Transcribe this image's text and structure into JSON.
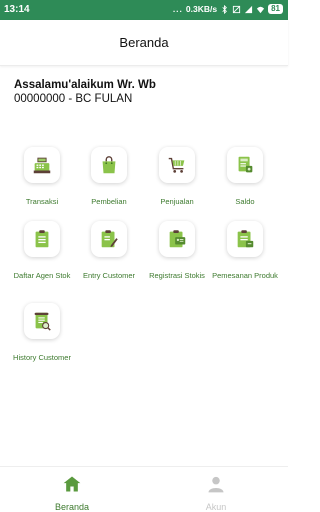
{
  "status_bar": {
    "time": "13:14",
    "dots": "...",
    "speed": "0.3KB/s",
    "battery": "81"
  },
  "header": {
    "title": "Beranda"
  },
  "user": {
    "greeting": "Assalamu'alaikum Wr. Wb",
    "account": "00000000 - BC FULAN"
  },
  "menu": [
    {
      "label": "Transaksi",
      "icon": "cash-register-icon"
    },
    {
      "label": "Pembelian",
      "icon": "shopping-bag-icon"
    },
    {
      "label": "Penjualan",
      "icon": "shopping-cart-icon"
    },
    {
      "label": "Saldo",
      "icon": "wallet-icon"
    },
    {
      "label": "Daftar Agen Stok",
      "icon": "clipboard-list-icon"
    },
    {
      "label": "Entry Customer",
      "icon": "clipboard-edit-icon"
    },
    {
      "label": "Registrasi Stokis",
      "icon": "id-card-icon"
    },
    {
      "label": "Pemesanan Produk",
      "icon": "clipboard-order-icon"
    },
    {
      "label": "History Customer",
      "icon": "history-scroll-icon"
    }
  ],
  "bottom_nav": [
    {
      "label": "Beranda",
      "icon": "home-icon",
      "active": true
    },
    {
      "label": "Akun",
      "icon": "user-icon",
      "active": false
    }
  ],
  "colors": {
    "status_bar": "#2e8b57",
    "accent_green": "#3d7a2e",
    "icon_green": "#8bc34a",
    "inactive": "#c6c6c6"
  }
}
